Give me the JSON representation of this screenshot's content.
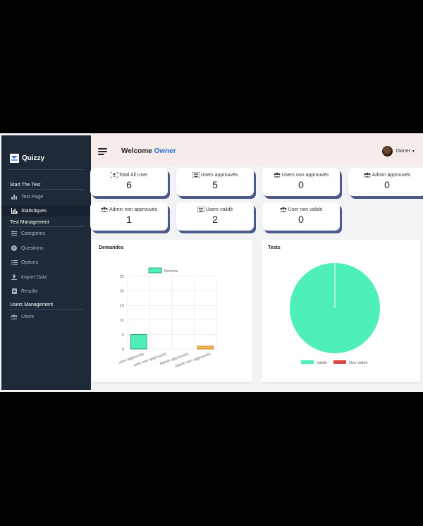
{
  "brand": {
    "name": "Quizzy"
  },
  "sidebar": {
    "sections": [
      {
        "title": "Start The Test"
      },
      {
        "title": "Test Management"
      },
      {
        "title": "Users Management"
      }
    ],
    "items": [
      {
        "label": "Test Page",
        "icon": "bar-chart-icon"
      },
      {
        "label": "Statistiques",
        "icon": "line-chart-icon"
      },
      {
        "label": "Categories",
        "icon": "list-icon"
      },
      {
        "label": "Questions",
        "icon": "question-icon"
      },
      {
        "label": "Options",
        "icon": "list-ordered-icon"
      },
      {
        "label": "Import Data",
        "icon": "upload-icon"
      },
      {
        "label": "Results",
        "icon": "results-icon"
      },
      {
        "label": "Users",
        "icon": "users-icon"
      }
    ]
  },
  "header": {
    "welcome_prefix": "Welcome",
    "welcome_name": "Owner",
    "user_name": "Owner"
  },
  "stats": [
    {
      "title": "Total All User",
      "value": "6"
    },
    {
      "title": "Users approuvés",
      "value": "5"
    },
    {
      "title": "Users non approuvés",
      "value": "0"
    },
    {
      "title": "Admin approuvés",
      "value": "0"
    },
    {
      "title": "Admin non approuvés",
      "value": "1"
    },
    {
      "title": "Users validé",
      "value": "2"
    },
    {
      "title": "User non validé",
      "value": "0"
    }
  ],
  "panels": {
    "demandes_title": "Demandes",
    "tests_title": "Tests"
  },
  "colors": {
    "sidebar": "#1f2a38",
    "accent": "#2b6fd6",
    "bar_green": "#4ef0b8",
    "bar_orange": "#f0b84e",
    "pie_red": "#e04545",
    "card_shadow": "#4e5a8a"
  },
  "chart_data": [
    {
      "type": "bar",
      "title": "Demandes",
      "categories": [
        "user approuvés",
        "user non approuvés",
        "Admin approuvés",
        "Admin non approuvés"
      ],
      "series": [
        {
          "name": "Nombre",
          "values": [
            5,
            0,
            0,
            1
          ]
        }
      ],
      "ylim": [
        0,
        25
      ],
      "yticks": [
        0,
        5,
        10,
        15,
        20,
        25
      ],
      "grid": true,
      "legend": "top"
    },
    {
      "type": "pie",
      "title": "Tests",
      "labels": [
        "Validé",
        "Non Validé"
      ],
      "values": [
        2,
        0
      ],
      "colors": [
        "#4ef0b8",
        "#e04545"
      ],
      "legend": "bottom"
    }
  ]
}
